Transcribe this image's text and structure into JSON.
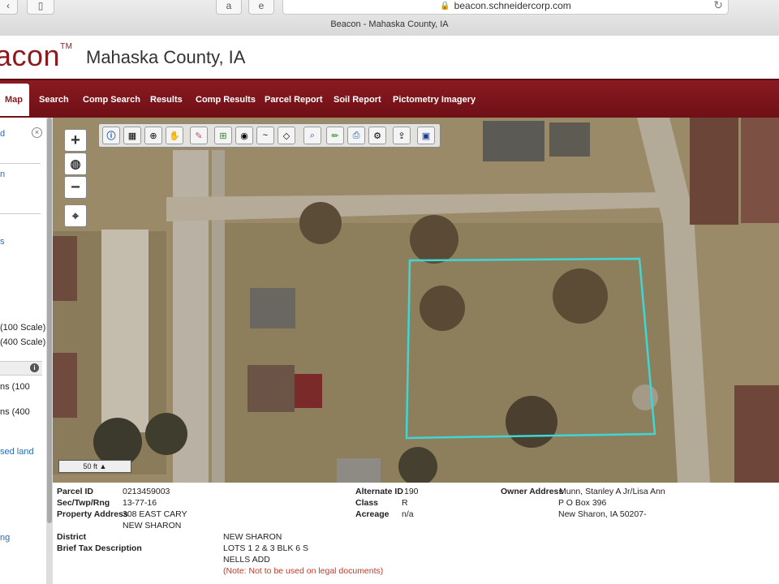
{
  "browser": {
    "url": "beacon.schneidercorp.com",
    "window_title": "Beacon - Mahaska County, IA"
  },
  "header": {
    "logo_text": "acon",
    "logo_tm": "TM",
    "county": "Mahaska County, IA"
  },
  "nav": {
    "items": [
      "Map",
      "Search",
      "Comp Search",
      "Results",
      "Comp Results",
      "Parcel Report",
      "Soil Report",
      "Pictometry Imagery"
    ]
  },
  "sidebar": {
    "items": [
      {
        "text": "d",
        "style": "link"
      },
      {
        "text": "n",
        "style": "link"
      },
      {
        "text": "s",
        "style": "link"
      },
      {
        "text": "(100 Scale)",
        "style": "dark"
      },
      {
        "text": "(400 Scale)",
        "style": "dark"
      },
      {
        "text": "ns (100",
        "style": "dark"
      },
      {
        "text": "ns (400",
        "style": "dark"
      },
      {
        "text": "sed land",
        "style": "link"
      },
      {
        "text": "ng",
        "style": "link"
      }
    ]
  },
  "map": {
    "scale_label": "50 ft",
    "parcel_outline_color": "#3fd6d6",
    "tools": [
      "info-icon",
      "identify-icon",
      "zoom-select-icon",
      "pan-hand-icon",
      "eraser-icon",
      "add-layer-icon",
      "photo-icon",
      "measure-icon",
      "buffer-icon",
      "search-map-icon",
      "draw-icon",
      "print-icon",
      "settings-icon",
      "export-icon",
      "save-icon"
    ]
  },
  "parcel": {
    "parcel_id_label": "Parcel ID",
    "parcel_id": "0213459003",
    "sec_label": "Sec/Twp/Rng",
    "sec": "13-77-16",
    "address_label": "Property Address",
    "address_1": "308 EAST CARY",
    "address_2": "NEW SHARON",
    "district_label": "District",
    "district": "NEW SHARON",
    "tax_label": "Brief Tax Description",
    "tax_1": "LOTS 1 2 & 3 BLK 6 S",
    "tax_2": "NELLS ADD",
    "tax_note": "(Note: Not to be used on legal documents)",
    "alt_id_label": "Alternate ID",
    "alt_id": "190",
    "class_label": "Class",
    "class": "R",
    "acreage_label": "Acreage",
    "acreage": "n/a",
    "owner_label": "Owner Address",
    "owner_1": "Munn, Stanley A Jr/Lisa Ann",
    "owner_2": "P O Box 396",
    "owner_3": "New Sharon, IA 50207-"
  }
}
